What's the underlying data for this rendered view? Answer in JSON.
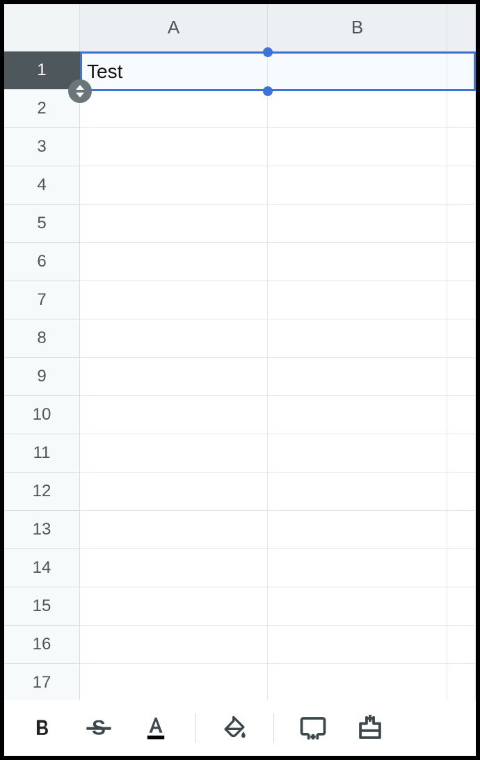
{
  "columns": [
    "A",
    "B"
  ],
  "rows": [
    "1",
    "2",
    "3",
    "4",
    "5",
    "6",
    "7",
    "8",
    "9",
    "10",
    "11",
    "12",
    "13",
    "14",
    "15",
    "16",
    "17"
  ],
  "selected_cell": {
    "row": 0,
    "col": 0,
    "value": "Test"
  },
  "selection_span_cols": 2,
  "cells": {
    "A1": "Test"
  },
  "toolbar": {
    "bold": "B",
    "strike": "S",
    "text_color": "A",
    "fill_color": "fill",
    "merge": "merge",
    "insert": "insert"
  }
}
